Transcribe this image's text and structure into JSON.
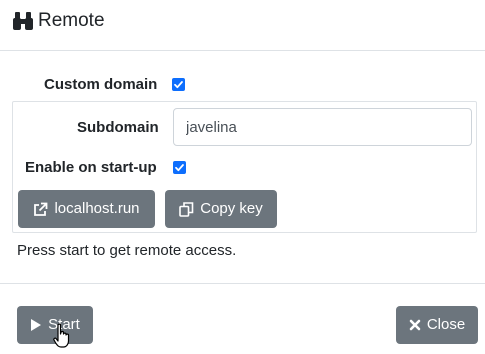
{
  "header": {
    "title": "Remote",
    "icon": "binoculars-icon"
  },
  "form": {
    "custom_domain": {
      "label": "Custom domain",
      "checked": true
    },
    "subdomain": {
      "label": "Subdomain",
      "value": "javelina"
    },
    "enable_startup": {
      "label": "Enable on start-up",
      "checked": true
    },
    "localhost_button": {
      "label": "localhost.run",
      "icon": "external-link-icon"
    },
    "copy_key_button": {
      "label": "Copy key",
      "icon": "copy-icon"
    }
  },
  "status_text": "Press start to get remote access.",
  "footer": {
    "start_button": {
      "label": "Start",
      "icon": "play-icon"
    },
    "close_button": {
      "label": "Close",
      "icon": "close-icon"
    }
  },
  "colors": {
    "button_bg": "#6c757d",
    "checkbox_accent": "#0d6efd",
    "border": "#dee2e6"
  }
}
